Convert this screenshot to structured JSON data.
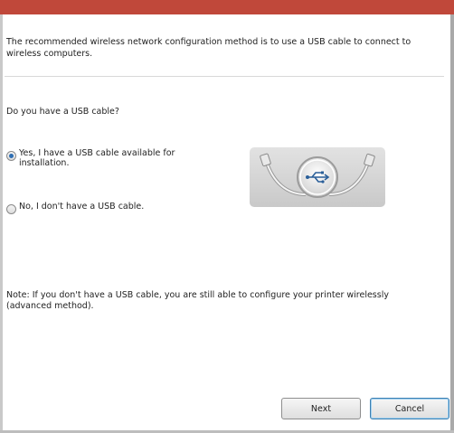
{
  "colors": {
    "title_bar": "#c0483a",
    "radio_selected": "#2f6fb3",
    "button_focus_border": "#3c7fb1"
  },
  "intro_text": "The recommended wireless network configuration method is to use a USB cable to connect to wireless computers.",
  "question": "Do you have a USB cable?",
  "options": [
    {
      "label": "Yes, I have a USB cable available for installation.",
      "selected": true
    },
    {
      "label": "No, I don't have a USB cable.",
      "selected": false
    }
  ],
  "illustration": {
    "icon": "usb-cable-icon"
  },
  "note": "Note:  If you don't have a USB cable, you are still able to configure your printer wirelessly (advanced method).",
  "buttons": {
    "next": "Next",
    "cancel": "Cancel"
  }
}
